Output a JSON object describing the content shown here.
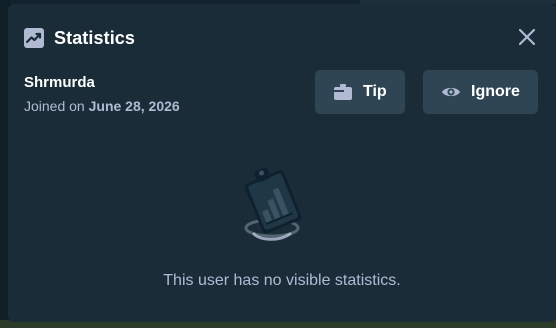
{
  "modal": {
    "title": "Statistics",
    "title_icon": "trend-chart-icon",
    "close_icon": "close-icon"
  },
  "user": {
    "name": "Shrmurda",
    "joined_prefix": "Joined on",
    "joined_date": "June 28, 2026"
  },
  "actions": {
    "tip_label": "Tip",
    "tip_icon": "wallet-icon",
    "ignore_label": "Ignore",
    "ignore_icon": "eye-icon"
  },
  "empty_state": {
    "icon": "clipboard-chart-icon",
    "message": "This user has no visible statistics."
  },
  "colors": {
    "background": "#1a2c38",
    "button": "#2f4553",
    "text_primary": "#ffffff",
    "text_secondary": "#b1bad3"
  }
}
